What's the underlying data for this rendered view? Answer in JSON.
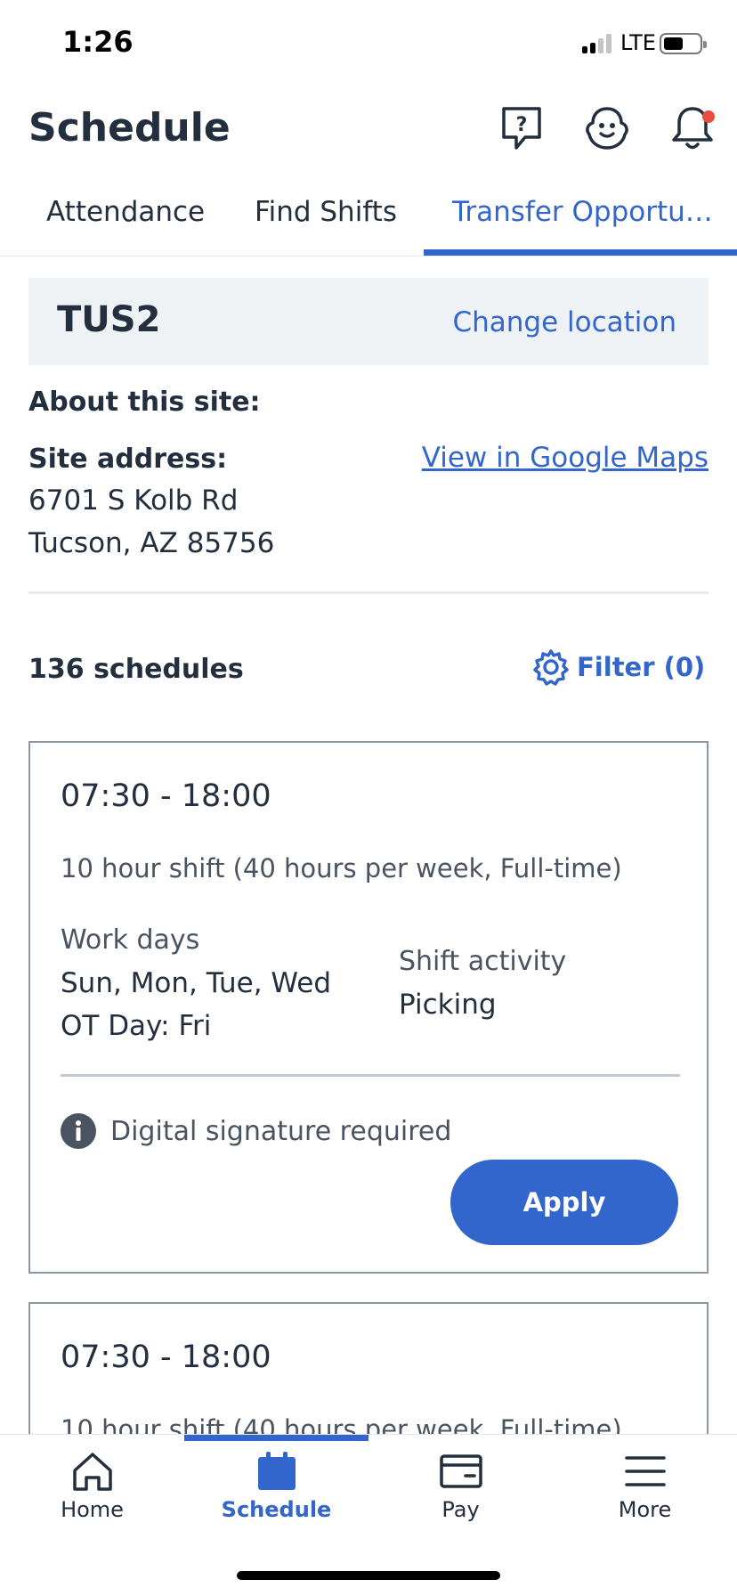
{
  "status_bar": {
    "time": "1:26",
    "network": "LTE"
  },
  "header": {
    "title": "Schedule",
    "icons": [
      "help-chat-icon",
      "assistant-icon",
      "bell-icon"
    ]
  },
  "tabs": [
    {
      "label": "Attendance",
      "active": false
    },
    {
      "label": "Find Shifts",
      "active": false
    },
    {
      "label": "Transfer Opportu…",
      "active": true
    }
  ],
  "location": {
    "name": "TUS2",
    "change_label": "Change location",
    "about_label": "About this site:",
    "address_label": "Site address:",
    "address_line1": "6701 S Kolb Rd",
    "address_line2": "Tucson, AZ 85756",
    "maps_link": "View in Google Maps"
  },
  "results": {
    "count_label": "136 schedules",
    "filter_label": "Filter (0)"
  },
  "schedules": [
    {
      "time": "07:30 - 18:00",
      "description": "10 hour shift (40 hours per week, Full-time)",
      "work_days_label": "Work days",
      "work_days": "Sun, Mon, Tue, Wed",
      "ot_day": "OT Day: Fri",
      "activity_label": "Shift activity",
      "activity": "Picking",
      "note": "Digital signature required",
      "apply_label": "Apply"
    },
    {
      "time": "07:30 - 18:00",
      "description": "10 hour shift (40 hours per week, Full-time)"
    }
  ],
  "bottom_nav": [
    {
      "label": "Home",
      "icon": "home-icon",
      "active": false
    },
    {
      "label": "Schedule",
      "icon": "calendar-icon",
      "active": true
    },
    {
      "label": "Pay",
      "icon": "wallet-icon",
      "active": false
    },
    {
      "label": "More",
      "icon": "menu-icon",
      "active": false
    }
  ],
  "colors": {
    "accent": "#3366cc",
    "text": "#232f3e",
    "notification": "#e84d3d"
  }
}
